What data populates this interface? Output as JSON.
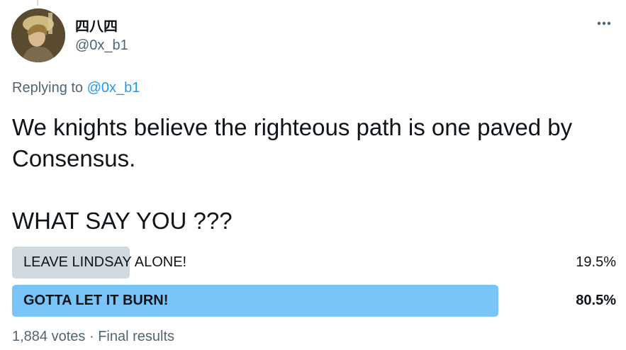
{
  "author": {
    "display_name": "四八四",
    "handle": "@0x_b1"
  },
  "reply": {
    "prefix": "Replying to",
    "to_handle": "@0x_b1"
  },
  "tweet": {
    "text": "We knights believe the righteous path is one paved by Consensus.\n\nWHAT SAY YOU ???"
  },
  "poll": {
    "options": [
      {
        "label": "LEAVE LINDSAY ALONE!",
        "percent_text": "19.5%",
        "fraction": 0.195,
        "winner": false,
        "color": "#cfd9de"
      },
      {
        "label": "GOTTA LET IT BURN!",
        "percent_text": "80.5%",
        "fraction": 0.805,
        "winner": true,
        "color": "#78c6f9"
      }
    ],
    "votes": "1,884 votes",
    "separator": "·",
    "status": "Final results"
  },
  "icons": {
    "more": "more-horizontal-icon"
  },
  "colors": {
    "link": "#1d9bf0",
    "secondary_text": "#536471",
    "loser_bar": "#cfd9de",
    "winner_bar": "#78c6f9"
  }
}
